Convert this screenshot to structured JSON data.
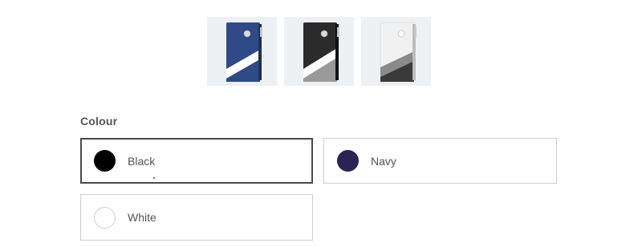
{
  "product_thumbnails": [
    {
      "colour": "Navy",
      "cover_color": "#2f4a86",
      "stripe_color": "#ffffff",
      "lower_color": "#2f4a86"
    },
    {
      "colour": "Black",
      "cover_color": "#2b2b2b",
      "stripe_color": "#ffffff",
      "lower_color": "#9a9a9a"
    },
    {
      "colour": "White",
      "cover_color": "#f1f1f1",
      "stripe_color": "#ffffff",
      "lower_color": "#3a3a3a"
    }
  ],
  "colour_selector": {
    "label": "Colour",
    "selected": "Black",
    "options": [
      {
        "label": "Black",
        "swatch_color": "#000000"
      },
      {
        "label": "Navy",
        "swatch_color": "#2a2355"
      },
      {
        "label": "White",
        "swatch_color": "#ffffff"
      }
    ]
  }
}
